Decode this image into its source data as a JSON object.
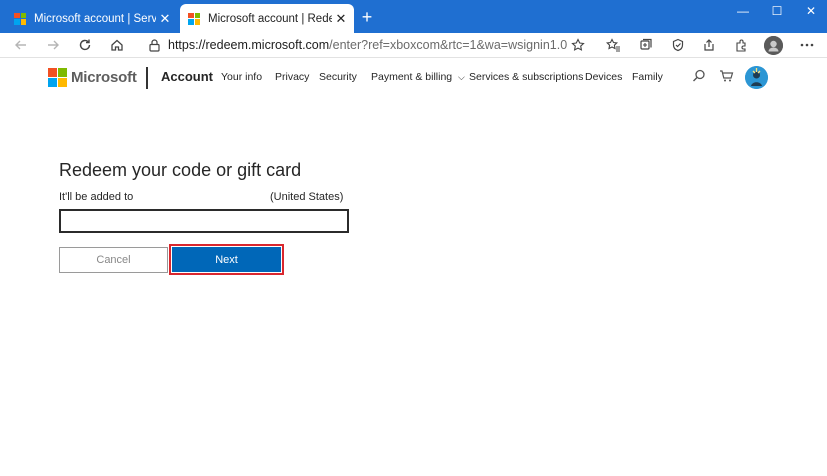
{
  "browser": {
    "tabs": [
      {
        "label": "Microsoft account | Services & s",
        "active": false
      },
      {
        "label": "Microsoft account | Redeem",
        "active": true
      }
    ],
    "tab_close": "✕",
    "new_tab": "+",
    "window_controls": {
      "minimize": "—",
      "maximize": "☐",
      "close": "✕"
    },
    "url_host": "https://redeem.microsoft.com",
    "url_path": "/enter?ref=xboxcom&rtc=1&wa=wsignin1.0",
    "icons": [
      "back-icon",
      "forward-icon",
      "refresh-icon",
      "home-icon",
      "lock-icon",
      "favorite-add-icon",
      "favorites-icon",
      "collections-icon",
      "browser-essentials-icon",
      "share-icon",
      "extensions-icon",
      "profile-icon",
      "more-icon"
    ]
  },
  "header": {
    "brand": "Microsoft",
    "section": "Account",
    "nav": [
      "Your info",
      "Privacy",
      "Security",
      "Payment & billing",
      "Services & subscriptions",
      "Devices",
      "Family"
    ],
    "payment_chevron": "⌵"
  },
  "main": {
    "heading": "Redeem your code or gift card",
    "added_to_label": "It'll be added to",
    "region": "(United States)",
    "code_value": "",
    "cancel_label": "Cancel",
    "next_label": "Next"
  },
  "colors": {
    "titlebar": "#1f6fd1",
    "primary_button": "#0067b8",
    "highlight_border": "#d9272e",
    "ms_red": "#f25022",
    "ms_green": "#7fba00",
    "ms_blue": "#00a4ef",
    "ms_yellow": "#ffb900"
  }
}
